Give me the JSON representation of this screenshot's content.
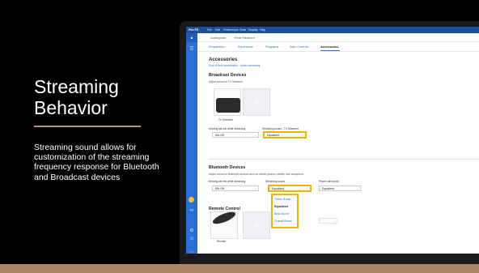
{
  "slide": {
    "title": "Streaming Behavior",
    "body": "Streaming sound allows for customization of the streaming frequency response for Bluetooth and Broadcast devices"
  },
  "colors": {
    "accent_bar": "#a88661",
    "app_blue": "#2b6fd6",
    "highlight": "#f0b400"
  },
  "app": {
    "titlebar": {
      "app_name": "Phn FS",
      "menu": [
        "File",
        "Edit",
        "Preferences",
        "Tools",
        "Display",
        "Help"
      ]
    },
    "toolbar": {
      "audiogram": "Audiogram",
      "realmeasure": "Real Measure"
    },
    "tabs": [
      "Preparation",
      "Experience",
      "Programs",
      "Gain Controls",
      "Accessories"
    ],
    "page_title": "Accessories",
    "tips": "How to test accessories  ·  Audio streaming",
    "broadcast": {
      "title": "Broadcast Devices",
      "subtitle": "Adjust sound for TV Streamer.",
      "device_label": "TV Streamer",
      "field1_label": "Hearing aid mic while streaming",
      "field1_value": "Mic Off",
      "field2_label": "Streaming sound - TV Streamer",
      "field2_value": "Equalized"
    },
    "bluetooth": {
      "title": "Bluetooth Devices",
      "subtitle": "Adjust sound for Bluetooth devices such as mobile phones, tablets, and computers.",
      "field1_label": "Hearing aid mic while streaming",
      "field1_value": "Mic Off",
      "field2_label": "Streaming sound",
      "field2_value": "Equalized",
      "field3_label": "Phone call sound",
      "field3_value": "Equalized",
      "dropdown_options": [
        "Treble Boost",
        "Equalized",
        "Bass Boost",
        "Overall Boost"
      ]
    },
    "remote": {
      "title": "Remote Control",
      "device_label": "Remote"
    }
  }
}
